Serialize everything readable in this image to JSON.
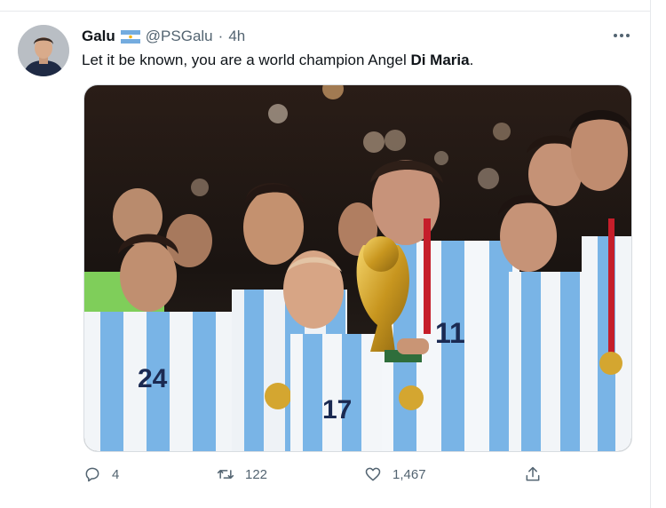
{
  "tweet": {
    "author_name": "Galu",
    "flag_icon": "argentina-flag-icon",
    "handle": "@PSGalu",
    "separator": "·",
    "time": "4h",
    "text_before": "Let it be known, you are a world champion Angel ",
    "text_bold": "Di Maria",
    "text_after": "."
  },
  "actions": {
    "reply_count": "4",
    "retweet_count": "122",
    "like_count": "1,467"
  },
  "colors": {
    "text": "#0f1419",
    "secondary": "#536471",
    "flag_blue": "#74acdf"
  }
}
